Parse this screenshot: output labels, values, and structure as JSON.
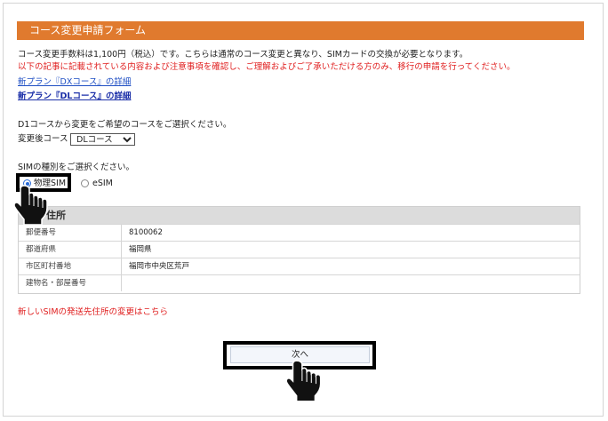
{
  "form": {
    "title": "コース変更申請フォーム",
    "fee_notice": "コース変更手数料は1,100円（税込）です。こちらは通常のコース変更と異なり、SIMカードの交換が必要となります。",
    "warning": "以下の記事に記載されている内容および注意事項を確認し、ご理解およびご了承いただける方のみ、移行の申請を行ってください。",
    "link_dx": "新プラン『DXコース』の詳細",
    "link_dl": "新プラン『DLコース』の詳細",
    "course_prompt": "D1コースから変更をご希望のコースをご選択ください。",
    "course_label": "変更後コース",
    "course_selected": "DLコース",
    "sim_prompt": "SIMの種別をご選択ください。",
    "sim_options": [
      {
        "label": "物理SIM",
        "checked": true
      },
      {
        "label": "eSIM",
        "checked": false
      }
    ],
    "address": {
      "heading": "住所",
      "rows": [
        {
          "key": "郵便番号",
          "value": "8100062"
        },
        {
          "key": "都道府県",
          "value": "福岡県"
        },
        {
          "key": "市区町村番地",
          "value": "福岡市中央区荒戸"
        },
        {
          "key": "建物名・部屋番号",
          "value": ""
        }
      ]
    },
    "change_address_link": "新しいSIMの発送先住所の変更はこちら",
    "next_button": "次へ"
  },
  "colors": {
    "header_bg": "#e07a2e",
    "warning_text": "#e02020",
    "link": "#1f4fc4",
    "highlight": "#000000"
  },
  "icons": [
    "pointing-hand-icon"
  ]
}
